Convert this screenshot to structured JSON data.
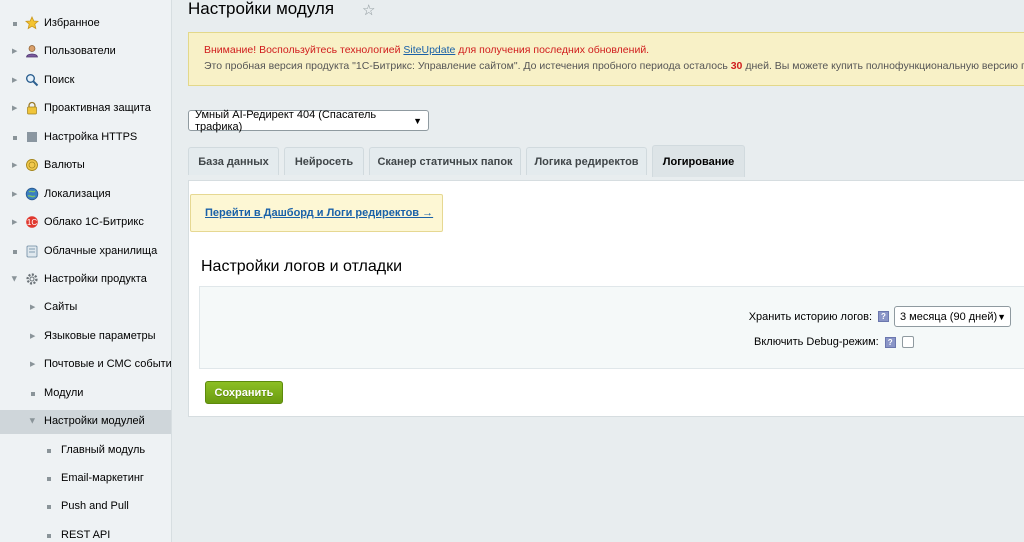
{
  "sidebar": {
    "items": [
      {
        "label": "Избранное",
        "icon": "star-icon"
      },
      {
        "label": "Пользователи",
        "icon": "user-icon"
      },
      {
        "label": "Поиск",
        "icon": "search-icon"
      },
      {
        "label": "Проактивная защита",
        "icon": "lock-icon"
      },
      {
        "label": "Настройка HTTPS",
        "icon": "https-icon"
      },
      {
        "label": "Валюты",
        "icon": "coin-icon"
      },
      {
        "label": "Локализация",
        "icon": "globe-icon"
      },
      {
        "label": "Облако 1С-Битрикс",
        "icon": "cloud-bitrix-icon"
      },
      {
        "label": "Облачные хранилища",
        "icon": "cloud-storage-icon"
      },
      {
        "label": "Настройки продукта",
        "icon": "gear-icon"
      },
      {
        "label": "Сайты"
      },
      {
        "label": "Языковые параметры"
      },
      {
        "label": "Почтовые и СМС события"
      },
      {
        "label": "Модули"
      },
      {
        "label": "Настройки модулей"
      },
      {
        "label": "Главный модуль"
      },
      {
        "label": "Email-маркетинг"
      },
      {
        "label": "Push and Pull"
      },
      {
        "label": "REST API"
      }
    ]
  },
  "header": {
    "title": "Настройки модуля",
    "favorite_icon": "star-outline-icon"
  },
  "notice": {
    "warning_prefix": "Внимание! Воспользуйтесь технологией",
    "link_text": "SiteUpdate",
    "warning_suffix": "для получения последних обновлений.",
    "trial_prefix": "Это пробная версия продукта \"1С-Битрикс: Управление сайтом\". До истечения пробного периода осталось",
    "days_left": "30",
    "trial_suffix": "дней. Вы можете купить полнофункциональную версию продукта"
  },
  "module_select": {
    "value": "Умный AI-Редирект 404 (Спасатель трафика)"
  },
  "tabs": [
    {
      "label": "База данных"
    },
    {
      "label": "Нейросеть"
    },
    {
      "label": "Сканер статичных папок"
    },
    {
      "label": "Логика редиректов"
    },
    {
      "label": "Логирование"
    }
  ],
  "content": {
    "dashboard_link": "Перейти в Дашборд и Логи редиректов →",
    "section_title": "Настройки логов и отладки",
    "history_label": "Хранить историю логов:",
    "history_value": "3 месяца (90 дней)",
    "debug_label": "Включить Debug-режим:",
    "debug_checked": false,
    "help_glyph": "?",
    "save_label": "Сохранить"
  },
  "colors": {
    "accent_green": "#6a9b10",
    "warning_red": "#d01c1c",
    "link_blue": "#1a61a8"
  }
}
